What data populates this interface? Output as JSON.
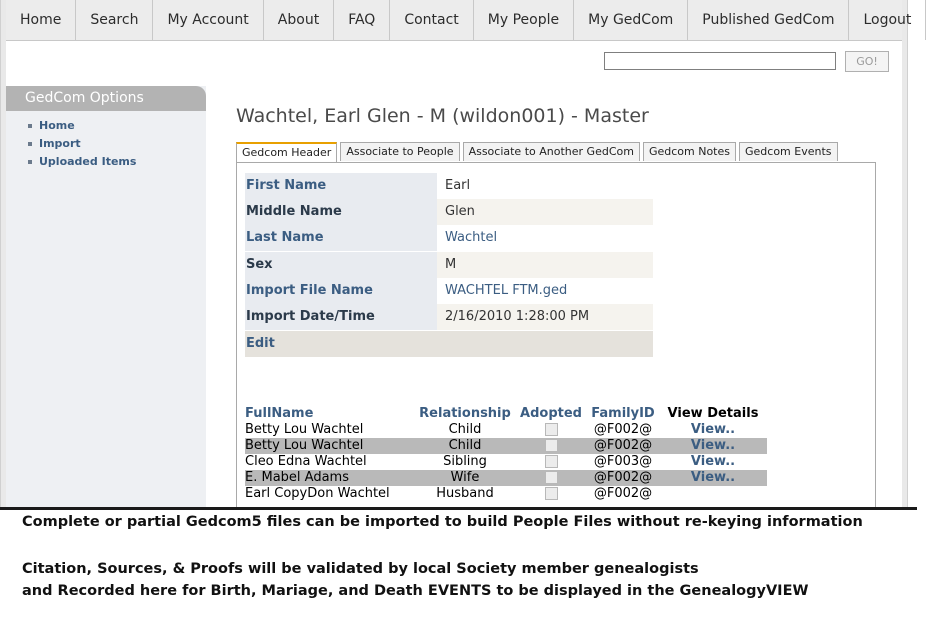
{
  "nav": {
    "items": [
      "Home",
      "Search",
      "My Account",
      "About",
      "FAQ",
      "Contact",
      "My People",
      "My GedCom",
      "Published GedCom",
      "Logout"
    ]
  },
  "search": {
    "value": "",
    "go_label": "GO!"
  },
  "sidebar": {
    "title": "GedCom Options",
    "items": [
      "Home",
      "Import",
      "Uploaded Items"
    ]
  },
  "page": {
    "title": "Wachtel, Earl Glen - M (wildon001) - Master"
  },
  "tabs": [
    "Gedcom Header",
    "Associate to People",
    "Associate to Another GedCom",
    "Gedcom Notes",
    "Gedcom Events"
  ],
  "fields": [
    {
      "label": "First Name",
      "value": "Earl"
    },
    {
      "label": "Middle Name",
      "value": "Glen"
    },
    {
      "label": "Last Name",
      "value": "Wachtel"
    },
    {
      "label": "Sex",
      "value": "M"
    },
    {
      "label": "Import File Name",
      "value": "WACHTEL FTM.ged"
    },
    {
      "label": "Import Date/Time",
      "value": "2/16/2010 1:28:00 PM"
    }
  ],
  "edit_label": "Edit",
  "relations": {
    "headers": [
      "FullName",
      "Relationship",
      "Adopted",
      "FamilyID",
      "View Details"
    ],
    "rows": [
      {
        "name": "Betty Lou Wachtel",
        "relationship": "Child",
        "family_id": "@F002@",
        "view": "View.."
      },
      {
        "name": "Betty Lou Wachtel",
        "relationship": "Child",
        "family_id": "@F002@",
        "view": "View.."
      },
      {
        "name": "Cleo Edna Wachtel",
        "relationship": "Sibling",
        "family_id": "@F003@",
        "view": "View.."
      },
      {
        "name": "E. Mabel Adams",
        "relationship": "Wife",
        "family_id": "@F002@",
        "view": "View.."
      },
      {
        "name": "Earl CopyDon Wachtel",
        "relationship": "Husband",
        "family_id": "@F002@",
        "view": ""
      }
    ]
  },
  "captions": [
    "Complete or partial Gedcom5 files can be imported to build People Files without re-keying information",
    "Citation, Sources,  & Proofs will be validated by local Society member genealogists",
    "and Recorded here for Birth, Mariage, and Death EVENTS to be displayed in the GenealogyVIEW"
  ]
}
